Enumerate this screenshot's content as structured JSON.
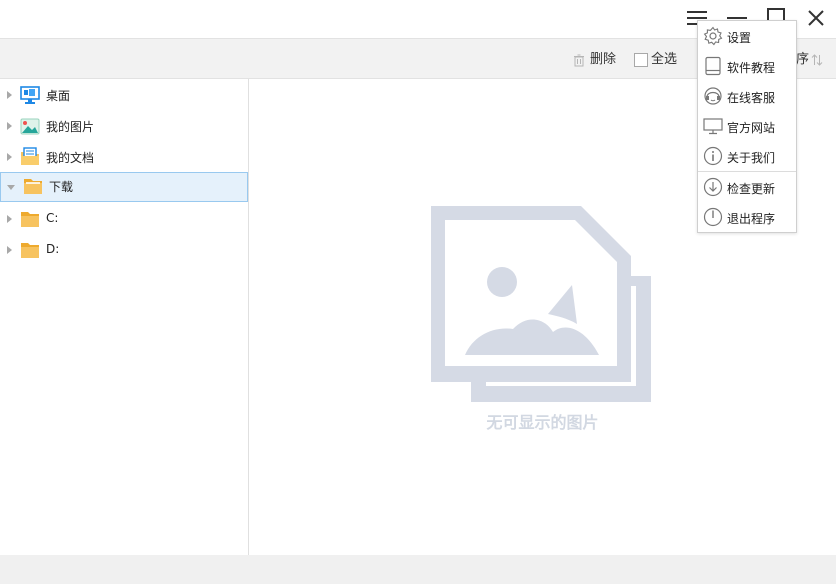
{
  "toolbar": {
    "delete_label": "删除",
    "select_all_label": "全选",
    "sort_label": "序"
  },
  "sidebar": {
    "items": [
      {
        "label": "桌面",
        "icon": "desktop-icon"
      },
      {
        "label": "我的图片",
        "icon": "pictures-folder-icon"
      },
      {
        "label": "我的文档",
        "icon": "documents-folder-icon"
      },
      {
        "label": "下载",
        "icon": "folder-icon",
        "selected": true
      },
      {
        "label": "C:",
        "icon": "folder-icon"
      },
      {
        "label": "D:",
        "icon": "folder-icon"
      }
    ]
  },
  "content": {
    "empty_message": "无可显示的图片"
  },
  "menu": {
    "items": [
      {
        "label": "设置",
        "icon": "gear-icon"
      },
      {
        "label": "软件教程",
        "icon": "book-icon"
      },
      {
        "label": "在线客服",
        "icon": "headset-icon"
      },
      {
        "label": "官方网站",
        "icon": "monitor-icon"
      },
      {
        "label": "关于我们",
        "icon": "info-icon"
      },
      {
        "label": "检查更新",
        "icon": "download-circle-icon"
      },
      {
        "label": "退出程序",
        "icon": "power-icon"
      }
    ]
  },
  "colors": {
    "selection_bg": "#e5f1fb",
    "selection_border": "#99c9ef",
    "folder_yellow": "#f7c35f",
    "placeholder_gray": "#d5dae5"
  }
}
